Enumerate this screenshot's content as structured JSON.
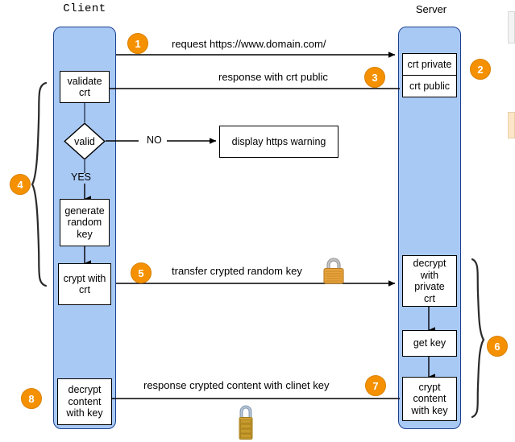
{
  "diagram": {
    "title_client": "Client",
    "title_server": "Server"
  },
  "client": {
    "nodes": [
      {
        "id": "validate-crt",
        "label": "validate\ncrt"
      },
      {
        "id": "valid-decision",
        "label": "valid"
      },
      {
        "id": "generate-random-key",
        "label": "generate\nrandom\nkey"
      },
      {
        "id": "crypt-with-crt",
        "label": "crypt with\ncrt"
      },
      {
        "id": "decrypt-content-with-key",
        "label": "decrypt\ncontent\nwith key"
      }
    ],
    "branch_yes": "YES",
    "branch_no": "NO"
  },
  "external": {
    "https_warning": "display https warning"
  },
  "server": {
    "nodes": [
      {
        "id": "crt-private",
        "label": "crt private"
      },
      {
        "id": "crt-public",
        "label": "crt public"
      },
      {
        "id": "decrypt-with-private-crt",
        "label": "decrypt\nwith\nprivate\ncrt"
      },
      {
        "id": "get-key",
        "label": "get key"
      },
      {
        "id": "crypt-content-with-key",
        "label": "crypt\ncontent\nwith key"
      }
    ]
  },
  "messages": {
    "m1": "request https://www.domain.com/",
    "m3": "response with crt public",
    "m5": "transfer crypted random key",
    "m7": "response crypted content with clinet key"
  },
  "badges": {
    "b1": "1",
    "b2": "2",
    "b3": "3",
    "b4": "4",
    "b5": "5",
    "b6": "6",
    "b7": "7",
    "b8": "8"
  },
  "icons": {
    "lock_closed": "padlock-icon",
    "lock_combination": "combination-padlock-icon"
  },
  "colors": {
    "lane_fill": "#a9c9f5",
    "lane_stroke": "#1b3f8f",
    "badge_fill": "#f59100",
    "node_fill": "#ffffff",
    "stroke": "#000000",
    "lock_body": "#e8a33d",
    "lock_shackle": "#9a9a9a"
  }
}
